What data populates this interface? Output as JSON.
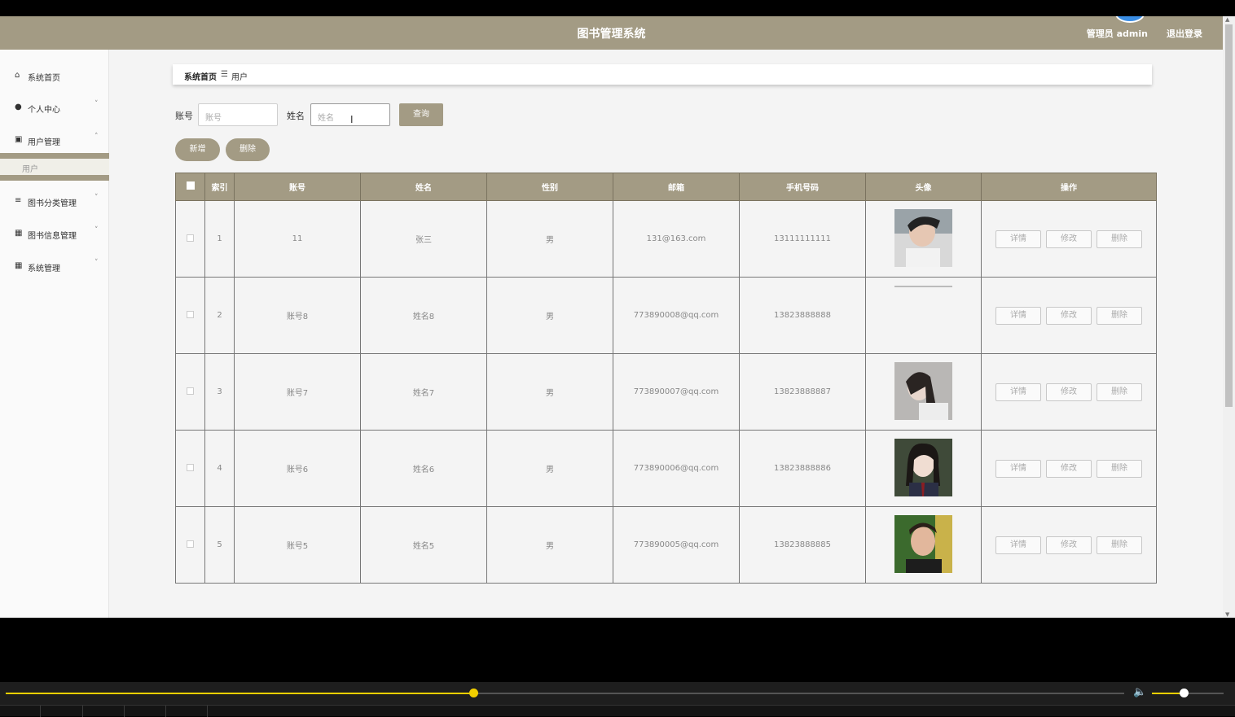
{
  "header": {
    "title": "图书管理系统",
    "admin_label": "管理员 admin",
    "logout_label": "退出登录"
  },
  "sidebar": {
    "items": [
      {
        "label": "系统首页",
        "icon": "home-icon",
        "glyph": "⌂"
      },
      {
        "label": "个人中心",
        "icon": "user-icon",
        "glyph": "●"
      },
      {
        "label": "用户管理",
        "icon": "clipboard-icon",
        "glyph": "▣"
      },
      {
        "label": "图书分类管理",
        "icon": "list-icon",
        "glyph": "≡"
      },
      {
        "label": "图书信息管理",
        "icon": "grid-icon",
        "glyph": "▦"
      },
      {
        "label": "系统管理",
        "icon": "grid-icon",
        "glyph": "▦"
      }
    ],
    "sub_item": "用户"
  },
  "breadcrumb": {
    "home": "系统首页",
    "separator": "☰",
    "current": "用户"
  },
  "search": {
    "account_label": "账号",
    "account_placeholder": "账号",
    "name_label": "姓名",
    "name_placeholder": "姓名",
    "query_label": "查询"
  },
  "actions": {
    "add_label": "新增",
    "delete_label": "删除"
  },
  "table": {
    "columns": [
      "索引",
      "账号",
      "姓名",
      "性别",
      "邮箱",
      "手机号码",
      "头像",
      "操作"
    ],
    "rows": [
      {
        "index": "1",
        "account": "11",
        "name": "张三",
        "gender": "男",
        "email": "131@163.com",
        "phone": "13111111111",
        "avatar": "photo-man-1"
      },
      {
        "index": "2",
        "account": "账号8",
        "name": "姓名8",
        "gender": "男",
        "email": "773890008@qq.com",
        "phone": "13823888888",
        "avatar": "none"
      },
      {
        "index": "3",
        "account": "账号7",
        "name": "姓名7",
        "gender": "男",
        "email": "773890007@qq.com",
        "phone": "13823888887",
        "avatar": "photo-woman-1"
      },
      {
        "index": "4",
        "account": "账号6",
        "name": "姓名6",
        "gender": "男",
        "email": "773890006@qq.com",
        "phone": "13823888886",
        "avatar": "photo-woman-2"
      },
      {
        "index": "5",
        "account": "账号5",
        "name": "姓名5",
        "gender": "男",
        "email": "773890005@qq.com",
        "phone": "13823888885",
        "avatar": "photo-man-2"
      }
    ],
    "row_actions": [
      "详情",
      "修改",
      "删除"
    ]
  },
  "player": {
    "progress": 0.418,
    "volume": 0.4
  },
  "colors": {
    "accent": "#a39b84",
    "progress": "#f2cf00"
  }
}
